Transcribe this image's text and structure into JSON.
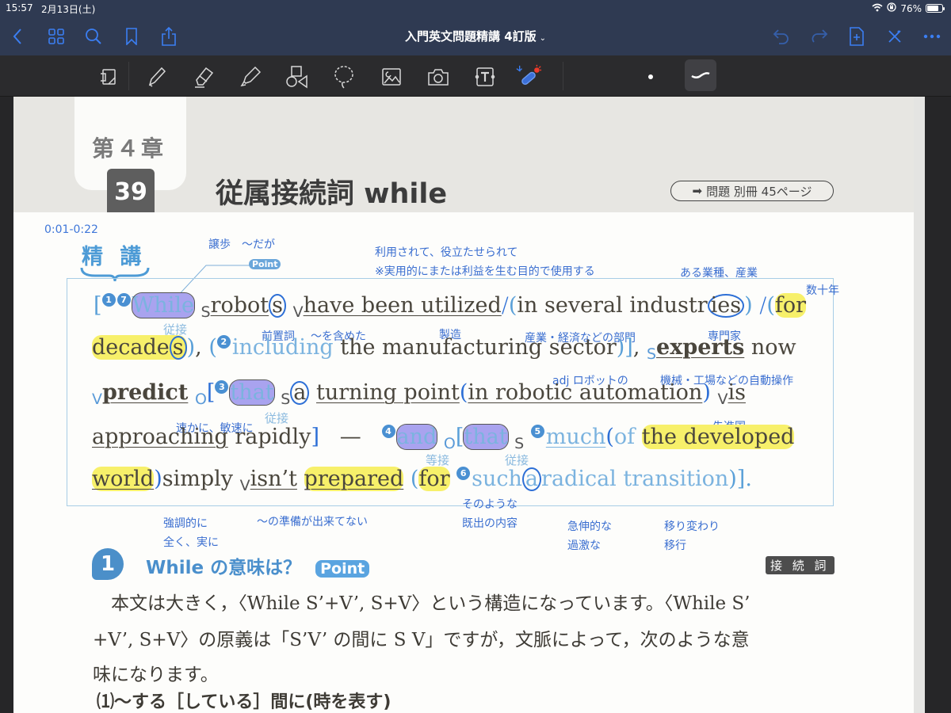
{
  "status": {
    "time": "15:57",
    "date": "2月13日(土)",
    "battery": "76%",
    "battery_level": 0.76
  },
  "nav": {
    "title": "入門英文問題精講 4訂版",
    "left_icons": [
      "back-icon",
      "grid-icon",
      "search-icon",
      "bookmark-icon",
      "share-icon"
    ],
    "right_icons": [
      "undo-icon",
      "redo-icon",
      "add-page-icon",
      "close-icon",
      "more-icon"
    ]
  },
  "toolbar": {
    "tools": [
      "read-mode",
      "pen",
      "eraser",
      "highlighter",
      "shapes",
      "lasso",
      "image",
      "camera",
      "text",
      "laser-pointer"
    ],
    "selected": "stroke-style"
  },
  "page": {
    "chapter": "第４章",
    "number": "39",
    "heading": "従属接続詞 while",
    "ref": "問題 別冊 45ページ",
    "timestamp": "0:01-0:22",
    "seiko": "精 講",
    "point_tag": "Point"
  },
  "annotations": {
    "jouho": "譲歩　～だが",
    "riyou1": "利用されて、役立たせられて",
    "riyou2": "※実用的にまたは利益を生む目的で使用する",
    "gyoushu": "ある業種、産業",
    "suujuunen": "数十年",
    "zensetsu": "前置詞",
    "fukumeta": "～を含めた",
    "seizou": "製造",
    "bumon": "産業・経済などの部門",
    "senmonka": "専門家",
    "robot": "adj ロボットの",
    "jidou": "機械・工場などの自動操作",
    "sokka": "速かに、敏速に",
    "senshin": "先進国",
    "kyouchou1": "強調的に",
    "kyouchou2": "全く、実に",
    "junbi": "～の準備が出来てない",
    "sono1": "そのような",
    "sono2": "既出の内容",
    "kyuushin1": "急伸的な",
    "kyuushin2": "過激な",
    "utsuri1": "移り変わり",
    "utsuri2": "移行",
    "juusetsu": "従接",
    "tousetsu": "等接"
  },
  "sentence": {
    "l1": {
      "n1": "1",
      "n7": "7",
      "while": "While",
      "s": "S",
      "robots": "robot",
      "robots_s": "s",
      "v": "V",
      "utilized": "have been utilized",
      "in": "in several industr",
      "ies": "ies",
      "for": "for"
    },
    "l2": {
      "decades": "decade",
      "s_end": "s",
      "n2": "2",
      "including": "including",
      "rest": "the manufacturing sector",
      "s": "S",
      "experts": "experts",
      "now": "now"
    },
    "l3": {
      "v": "V",
      "predict": "predict",
      "o": "O",
      "n3": "3",
      "that": "that",
      "s": "S",
      "a": "a",
      "turning": "turning point",
      "in": "in robotic automation",
      "v2": "V",
      "is": "is"
    },
    "l4": {
      "approaching": "approaching",
      "rapidly": "rapidly",
      "dash": "—",
      "n4": "4",
      "and": "and",
      "o": "O",
      "that": "that",
      "s": "S",
      "n5": "5",
      "much": "much",
      "of": "of",
      "developed": "the developed"
    },
    "l5": {
      "world": "world",
      "simply": "simply",
      "v": "V",
      "isnt": "isn’t",
      "prepared": "prepared",
      "for": "for",
      "n6": "6",
      "such": "such",
      "a": "a",
      "radical": "radical transition",
      "end": ")].",
      "dot": ""
    }
  },
  "section": {
    "num": "1",
    "title": "While の意味は？",
    "point": "Point",
    "tag": "接 続 詞",
    "p1": "本文は大きく，〈While S’+V’, S+V〉という構造になっています。〈While S’",
    "p2": "+V’, S+V〉の原義は「S’V’ の間に S V」ですが，文脈によって，次のような意",
    "p3": "味になります。",
    "sub": "⑴～する［している］間に(時を表す)"
  }
}
